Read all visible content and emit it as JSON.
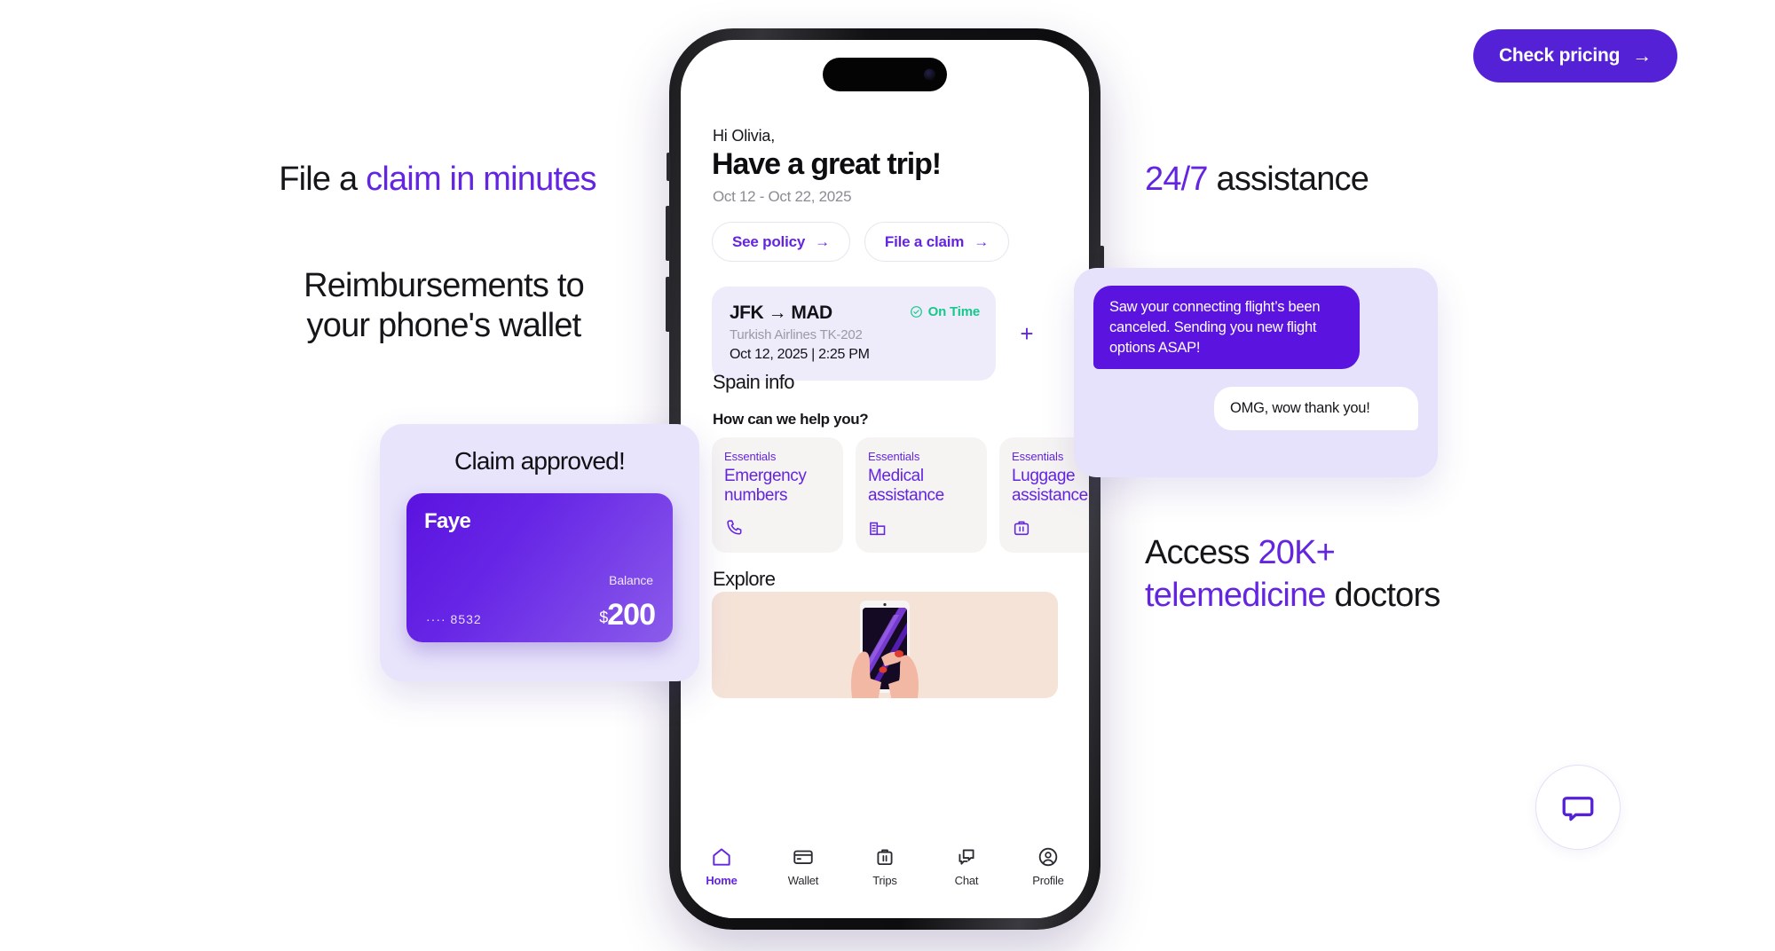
{
  "cta": {
    "label": "Check pricing",
    "arrow": "→",
    "color": "#5521d6"
  },
  "headlines": [
    {
      "id": "claim",
      "pre": "File a ",
      "highlight": "claim in minutes",
      "post": ""
    },
    {
      "id": "reimburse",
      "pre": "Reimbursements to\nyour phone's wallet",
      "highlight": "",
      "post": ""
    },
    {
      "id": "assistance",
      "pre": "",
      "highlight": "24/7",
      "post": " assistance"
    },
    {
      "id": "telemed",
      "pre": "Access ",
      "highlight": "20K+\ntelemedicine",
      "post": " doctors"
    }
  ],
  "accent": {
    "purple": "#6425e0",
    "deep_purple": "#5521d6",
    "green": "#14c98a",
    "lilac_bg": "#e8e4fb"
  },
  "phone": {
    "greeting_small": "Hi Olivia,",
    "greeting_large": "Have a great trip!",
    "trip_dates": "Oct 12 - Oct 22, 2025",
    "pills": [
      {
        "label": "See policy",
        "arrow": "→"
      },
      {
        "label": "File a claim",
        "arrow": "→"
      }
    ],
    "flight": {
      "route": "JFK → MAD",
      "airline": "Turkish Airlines TK-202",
      "datetime": "Oct 12, 2025 | 2:25 PM",
      "status": "On Time",
      "add_label": "+"
    },
    "section_spain": "Spain info",
    "help_prompt": "How can we help you?",
    "help_cards": [
      {
        "kicker": "Essentials",
        "title": "Emergency\nnumbers",
        "icon": "phone-icon"
      },
      {
        "kicker": "Essentials",
        "title": "Medical\nassistance",
        "icon": "hospital-icon"
      },
      {
        "kicker": "Essentials",
        "title": "Luggage\nassistance",
        "icon": "suitcase-icon"
      }
    ],
    "section_explore": "Explore",
    "tabs": [
      {
        "label": "Home",
        "icon": "home-icon",
        "active": true
      },
      {
        "label": "Wallet",
        "icon": "card-icon",
        "active": false
      },
      {
        "label": "Trips",
        "icon": "suitcase-icon",
        "active": false
      },
      {
        "label": "Chat",
        "icon": "chat-icon",
        "active": false
      },
      {
        "label": "Profile",
        "icon": "person-icon",
        "active": false
      }
    ]
  },
  "claim_popup": {
    "title": "Claim approved!",
    "card_brand": "Faye",
    "card_last4": "···· 8532",
    "balance_label": "Balance",
    "currency": "$",
    "amount": "200"
  },
  "chat_popup": {
    "agent_message": "Saw your connecting flight’s been canceled. Sending you new flight options ASAP!",
    "user_message": "OMG, wow thank you!"
  },
  "chat_launcher": {
    "icon": "chat-bubble-icon"
  }
}
